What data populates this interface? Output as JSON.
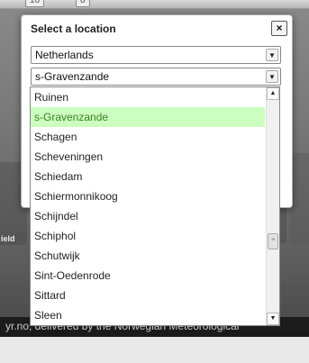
{
  "background": {
    "top_controls": [
      "16",
      "8"
    ],
    "side_label": "ield",
    "credit": "yr.no, delivered by the Norwegian Meteorological"
  },
  "dialog": {
    "title": "Select a location",
    "close_label": "×",
    "country_select": {
      "value": "Netherlands"
    },
    "city_select": {
      "value": "s-Gravenzande"
    }
  },
  "city_list": {
    "items": [
      "Ruinen",
      "s-Gravenzande",
      "Schagen",
      "Scheveningen",
      "Schiedam",
      "Schiermonnikoog",
      "Schijndel",
      "Schiphol",
      "Schutwijk",
      "Sint-Oedenrode",
      "Sittard",
      "Sleen"
    ],
    "selected_index": 1,
    "scroll_position": 0.68
  },
  "colors": {
    "selected_bg": "#ccffc0",
    "selected_text": "#3a7f22"
  }
}
